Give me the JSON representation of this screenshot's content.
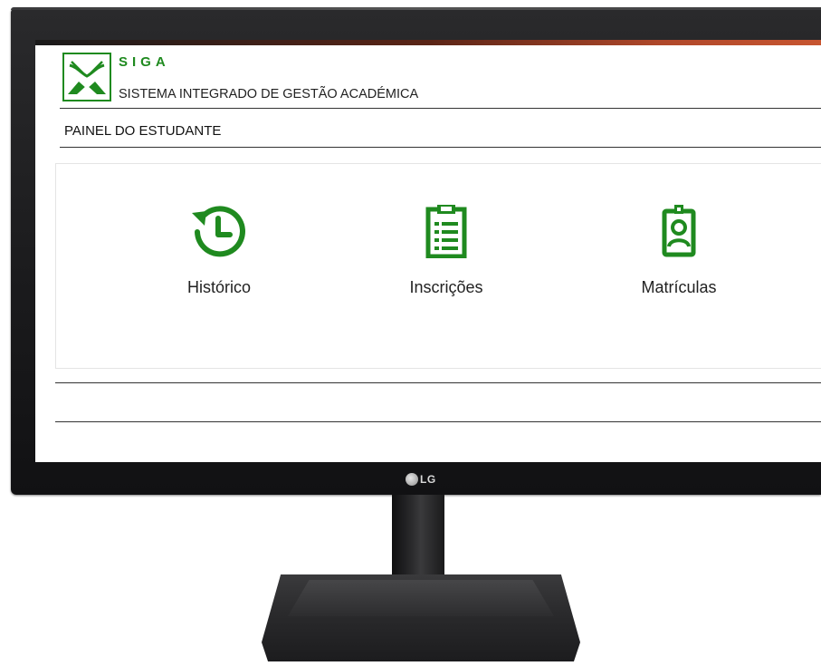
{
  "monitor": {
    "brand": "LG"
  },
  "app": {
    "logo_text": "SIGA",
    "subtitle": "SISTEMA INTEGRADO DE GESTÃO ACADÉMICA",
    "panel_title": "PAINEL DO ESTUDANTE",
    "accent_color": "#1f8a1f"
  },
  "tiles": [
    {
      "label": "Histórico",
      "icon": "history-icon"
    },
    {
      "label": "Inscrições",
      "icon": "clipboard-list-icon"
    },
    {
      "label": "Matrículas",
      "icon": "id-badge-icon"
    }
  ]
}
